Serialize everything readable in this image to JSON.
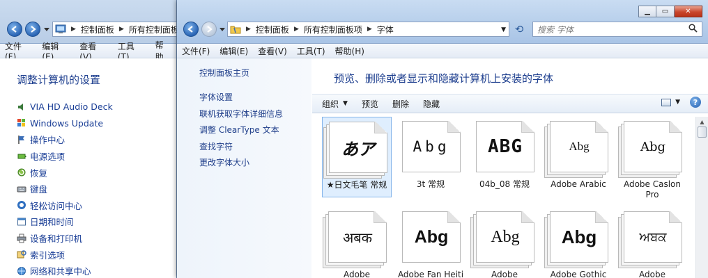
{
  "back_window": {
    "address": {
      "crumbs": [
        "控制面板",
        "所有控制面板"
      ]
    },
    "menu": [
      "文件(F)",
      "编辑(E)",
      "查看(V)",
      "工具(T)",
      "帮助"
    ],
    "title": "调整计算机的设置",
    "items": [
      {
        "label": "VIA HD Audio Deck",
        "icon": "speaker-icon"
      },
      {
        "label": "Windows Update",
        "icon": "windows-update-icon"
      },
      {
        "label": "操作中心",
        "icon": "flag-icon"
      },
      {
        "label": "电源选项",
        "icon": "power-icon"
      },
      {
        "label": "恢复",
        "icon": "recovery-icon"
      },
      {
        "label": "键盘",
        "icon": "keyboard-icon"
      },
      {
        "label": "轻松访问中心",
        "icon": "ease-of-access-icon"
      },
      {
        "label": "日期和时间",
        "icon": "calendar-icon"
      },
      {
        "label": "设备和打印机",
        "icon": "printer-icon"
      },
      {
        "label": "索引选项",
        "icon": "index-icon"
      },
      {
        "label": "网络和共享中心",
        "icon": "network-icon"
      }
    ]
  },
  "front_window": {
    "address": {
      "crumbs": [
        "控制面板",
        "所有控制面板项",
        "字体"
      ]
    },
    "search_placeholder": "搜索 字体",
    "menu": [
      "文件(F)",
      "编辑(E)",
      "查看(V)",
      "工具(T)",
      "帮助(H)"
    ],
    "nav": {
      "home": "控制面板主页",
      "links": [
        "字体设置",
        "联机获取字体详细信息",
        "调整 ClearType 文本",
        "查找字符",
        "更改字体大小"
      ]
    },
    "title": "预览、删除或者显示和隐藏计算机上安装的字体",
    "commands": {
      "organize": "组织",
      "preview": "预览",
      "delete": "删除",
      "hide": "隐藏"
    },
    "fonts": [
      {
        "name": "★日文毛笔 常规",
        "sample": "あア",
        "selected": true,
        "family": "collection"
      },
      {
        "name": "3t 常规",
        "sample": "Abg",
        "selected": false,
        "family": "single"
      },
      {
        "name": "04b_08 常规",
        "sample": "ABG",
        "selected": false,
        "family": "single"
      },
      {
        "name": "Adobe Arabic",
        "sample": "Abg",
        "selected": false,
        "family": "collection"
      },
      {
        "name": "Adobe Caslon Pro",
        "sample": "Abg",
        "selected": false,
        "family": "collection"
      },
      {
        "name": "Adobe",
        "sample": "अबक",
        "selected": false,
        "family": "collection"
      },
      {
        "name": "Adobe Fan Heiti",
        "sample": "Abg",
        "selected": false,
        "family": "single"
      },
      {
        "name": "Adobe",
        "sample": "Abg",
        "selected": false,
        "family": "collection"
      },
      {
        "name": "Adobe Gothic",
        "sample": "Abg",
        "selected": false,
        "family": "collection"
      },
      {
        "name": "Adobe",
        "sample": "ਅਬਕ",
        "selected": false,
        "family": "collection"
      }
    ]
  },
  "colors": {
    "link": "#1a3e96",
    "title": "#1e3f8f",
    "selection": "#dfeefe"
  }
}
